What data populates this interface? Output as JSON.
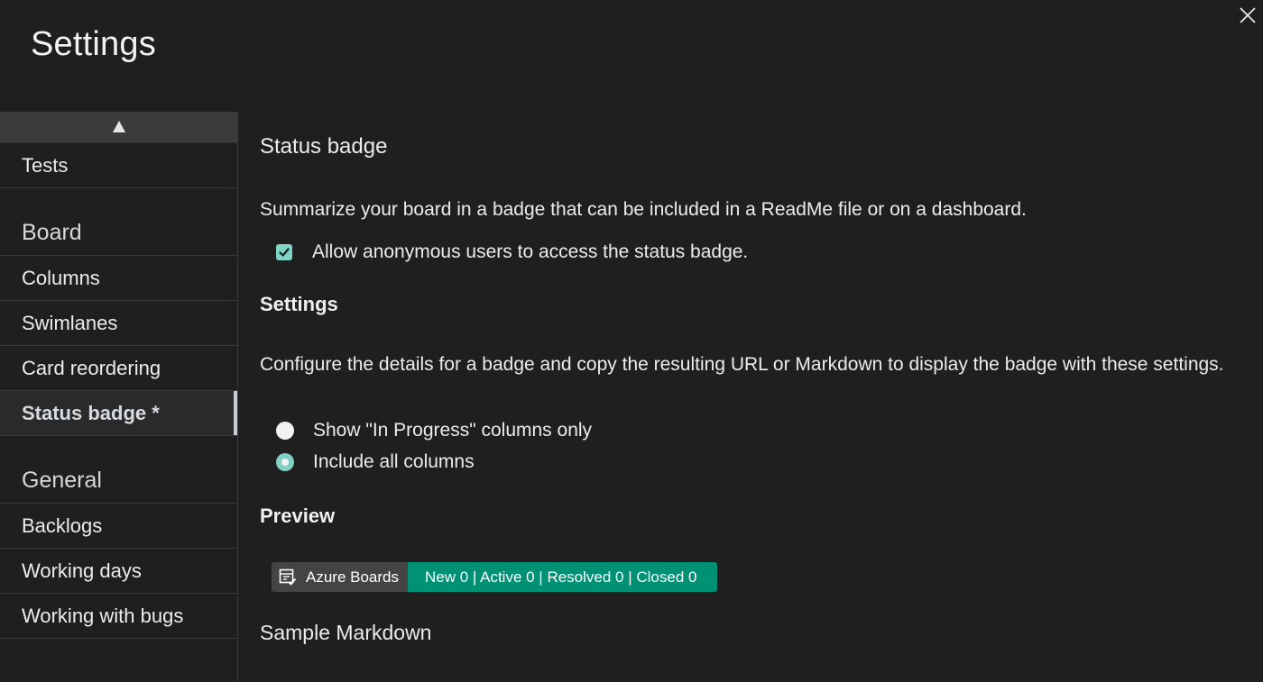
{
  "window": {
    "title": "Settings",
    "close_icon": "close-icon"
  },
  "sidebar": {
    "scroll_up_icon": "triangle-up-icon",
    "items_top": [
      {
        "label": "Tests"
      }
    ],
    "groups": [
      {
        "title": "Board",
        "items": [
          {
            "label": "Columns"
          },
          {
            "label": "Swimlanes"
          },
          {
            "label": "Card reordering"
          },
          {
            "label": "Status badge *",
            "active": true
          }
        ]
      },
      {
        "title": "General",
        "items": [
          {
            "label": "Backlogs"
          },
          {
            "label": "Working days"
          },
          {
            "label": "Working with bugs"
          }
        ]
      }
    ]
  },
  "main": {
    "section_title": "Status badge",
    "description": "Summarize your board in a badge that can be included in a ReadMe file or on a dashboard.",
    "anonymous_checkbox": {
      "label": "Allow anonymous users to access the status badge.",
      "checked": true
    },
    "settings_heading": "Settings",
    "settings_description": "Configure the details for a badge and copy the resulting URL or Markdown to display the badge with these settings.",
    "radio_options": [
      {
        "label": "Show \"In Progress\" columns only",
        "selected": false
      },
      {
        "label": "Include all columns",
        "selected": true
      }
    ],
    "preview_heading": "Preview",
    "badge": {
      "left_label": "Azure Boards",
      "right_label": "New 0 | Active 0 | Resolved 0 | Closed 0",
      "left_color": "#444444",
      "right_color": "#009175",
      "icon": "azure-boards-icon"
    },
    "sample_markdown_heading": "Sample Markdown"
  },
  "colors": {
    "background": "#1f1f1f",
    "accent_teal": "#7fd3c7",
    "active_indicator": "#c7ced6"
  }
}
